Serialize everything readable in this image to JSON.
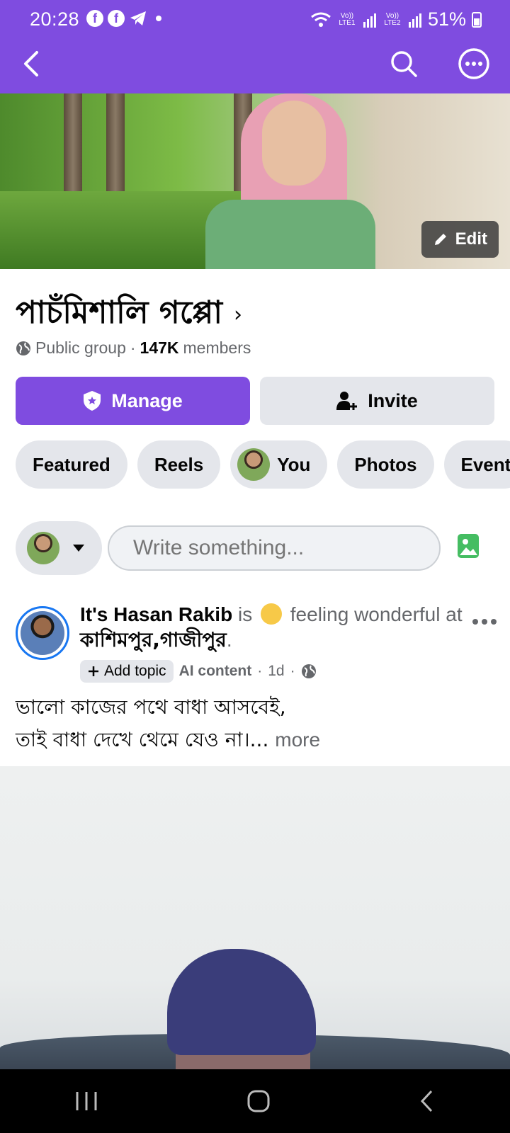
{
  "status_bar": {
    "time": "20:28",
    "battery": "51%",
    "sim1": "Vo)) LTE1",
    "sim2": "Vo)) LTE2"
  },
  "top_bar": {
    "back_icon": "chevron-left-icon",
    "search_icon": "search-icon",
    "more_icon": "more-horizontal-icon"
  },
  "cover": {
    "edit_label": "Edit"
  },
  "group": {
    "name": "পাচঁমিশালি গপ্পো",
    "privacy": "Public group",
    "separator": "·",
    "member_count": "147K",
    "members_label": "members"
  },
  "actions": {
    "manage_label": "Manage",
    "invite_label": "Invite"
  },
  "tabs": [
    {
      "label": "Featured"
    },
    {
      "label": "Reels"
    },
    {
      "label": "You"
    },
    {
      "label": "Photos"
    },
    {
      "label": "Event"
    }
  ],
  "composer": {
    "placeholder": "Write something..."
  },
  "post": {
    "author": "It's Hasan Rakib",
    "is": "is",
    "feeling": "feeling",
    "wonderful_at": "wonderful at",
    "location": "কাশিমপুর,গাজীপুর",
    "period": ".",
    "add_topic": "Add topic",
    "ai_content": "AI content",
    "dot": "·",
    "time": "1d",
    "line1": "ভালো কাজের পথে বাধা আসবেই,",
    "line2": "তাই বাধা দেখে থেমে যেও না।...",
    "more": "more"
  },
  "colors": {
    "brand": "#7f4ce0",
    "chip_bg": "#e4e6eb",
    "secondary_text": "#65676b",
    "photo_green": "#45bd62",
    "story_ring": "#1877f2"
  }
}
